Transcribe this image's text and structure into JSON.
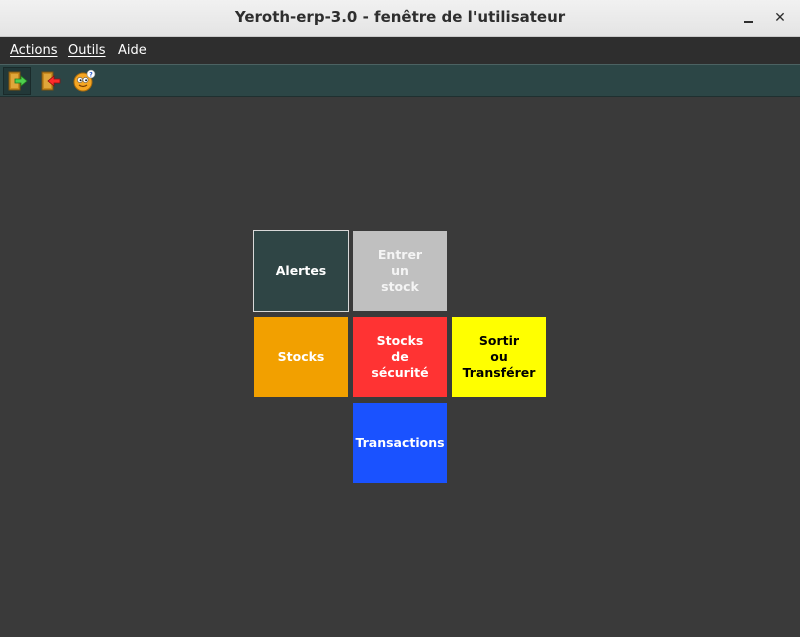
{
  "window": {
    "title": "Yeroth-erp-3.0 - fenêtre de l'utilisateur",
    "minimize_glyph": "",
    "close_glyph": "✕"
  },
  "menubar": {
    "actions": "Actions",
    "outils": "Outils",
    "aide": "Aide"
  },
  "toolbar": {
    "icons": [
      "login-icon",
      "logout-icon",
      "about-icon"
    ]
  },
  "tiles": {
    "alertes": {
      "label": "Alertes",
      "color": "#2f4545"
    },
    "entrer": {
      "line1": "Entrer",
      "line2": "un",
      "line3": "stock",
      "color": "#c0c0c0"
    },
    "stocks": {
      "label": "Stocks",
      "color": "#f2a000"
    },
    "securite": {
      "line1": "Stocks",
      "line2": "de",
      "line3": "sécurité",
      "color": "#ff3333"
    },
    "sortir": {
      "line1": "Sortir",
      "line2": "ou",
      "line3": "Transférer",
      "color": "#ffff00"
    },
    "transactions": {
      "label": "Transactions",
      "color": "#1a52ff"
    }
  }
}
